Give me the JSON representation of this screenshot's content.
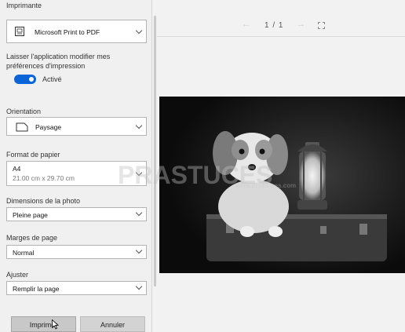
{
  "printer": {
    "section_label": "Imprimante",
    "selected": "Microsoft Print to PDF"
  },
  "app_prefs": {
    "label_line1": "Laisser l'application modifier mes",
    "label_line2": "préférences d'impression",
    "toggle_state": "Activé",
    "toggle_on": true
  },
  "orientation": {
    "label": "Orientation",
    "selected": "Paysage"
  },
  "paper_format": {
    "label": "Format de papier",
    "selected_name": "A4",
    "selected_size": "21.00 cm x 29.70 cm"
  },
  "photo_dimensions": {
    "label": "Dimensions de la photo",
    "selected": "Pleine page"
  },
  "margins": {
    "label": "Marges de page",
    "selected": "Normal"
  },
  "fit": {
    "label": "Ajuster",
    "selected": "Remplir la page"
  },
  "buttons": {
    "print": "Imprimer",
    "cancel": "Annuler"
  },
  "preview": {
    "page_indicator": "1 / 1",
    "prev_icon": "arrow-left-icon",
    "next_icon": "arrow-right-icon",
    "fit_icon": "fullscreen-icon"
  },
  "colors": {
    "accent": "#0a64d6",
    "panel_bg": "#f0f0f0"
  }
}
